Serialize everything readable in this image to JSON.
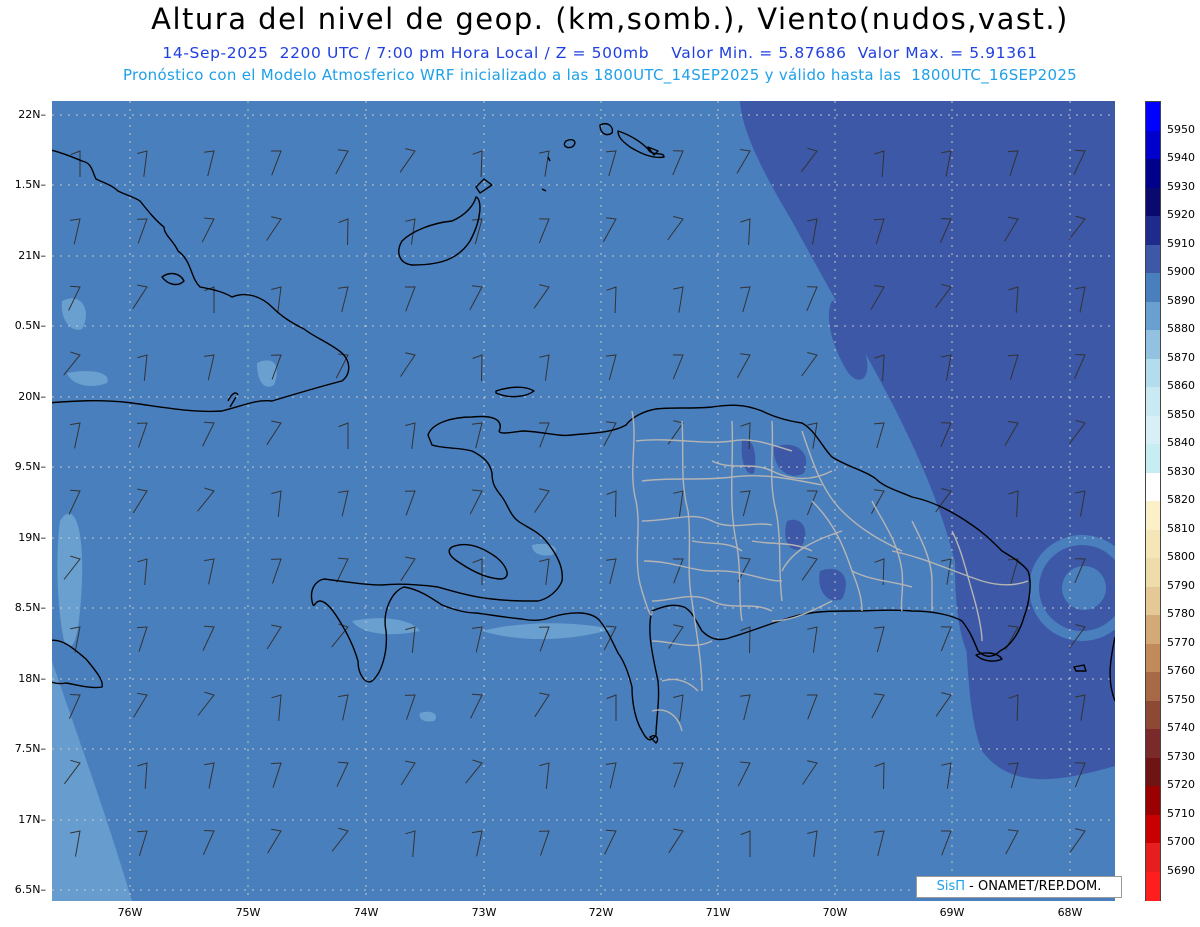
{
  "header": {
    "title": "Altura del nivel de geop. (km,somb.), Viento(nudos,vast.)",
    "subtitle1": "14-Sep-2025  2200 UTC / 7:00 pm Hora Local / Z = 500mb    Valor Min. = 5.87686  Valor Max. = 5.91361",
    "subtitle2": "Pronóstico con el Modelo Atmosferico WRF inicializado a las 1800UTC_14SEP2025 y válido hasta las  1800UTC_16SEP2025"
  },
  "map": {
    "lat_labels": [
      "22N",
      "1.5N",
      "21N",
      "0.5N",
      "20N",
      "9.5N",
      "19N",
      "8.5N",
      "18N",
      "7.5N",
      "17N",
      "6.5N"
    ],
    "lon_labels": [
      "76W",
      "75W",
      "74W",
      "73W",
      "72W",
      "71W",
      "70W",
      "69W",
      "68W"
    ],
    "colors": {
      "base_field": "#4a7fbd",
      "high_field": "#3c58a6",
      "low_field": "#6aa0cf",
      "coastline": "#000000",
      "provinces": "#b4b4b4",
      "grid": "#c8c8c8"
    }
  },
  "colorbar": {
    "labels": [
      "5950",
      "5940",
      "5930",
      "5920",
      "5910",
      "5900",
      "5890",
      "5880",
      "5870",
      "5860",
      "5850",
      "5840",
      "5830",
      "5820",
      "5810",
      "5800",
      "5790",
      "5780",
      "5770",
      "5760",
      "5750",
      "5740",
      "5730",
      "5720",
      "5710",
      "5700",
      "5690"
    ],
    "colors": [
      "#0000ff",
      "#0000cd",
      "#00008b",
      "#0a0a6e",
      "#1e2a8c",
      "#3c58a6",
      "#4a7fbd",
      "#6aa0cf",
      "#93c1e0",
      "#b5dcec",
      "#c9eaf2",
      "#d8f0f5",
      "#c6eef2",
      "#ffffff",
      "#fbf0c8",
      "#f5e6b8",
      "#eedcaa",
      "#e4c896",
      "#d4a978",
      "#c08a5a",
      "#a86a46",
      "#8c4a36",
      "#7a2a2a",
      "#6e1414",
      "#9a0000",
      "#c80000",
      "#e61e1e",
      "#ff1e1e"
    ]
  },
  "credit": {
    "brand": "SisΠ",
    "text": " - ONAMET/REP.DOM."
  }
}
